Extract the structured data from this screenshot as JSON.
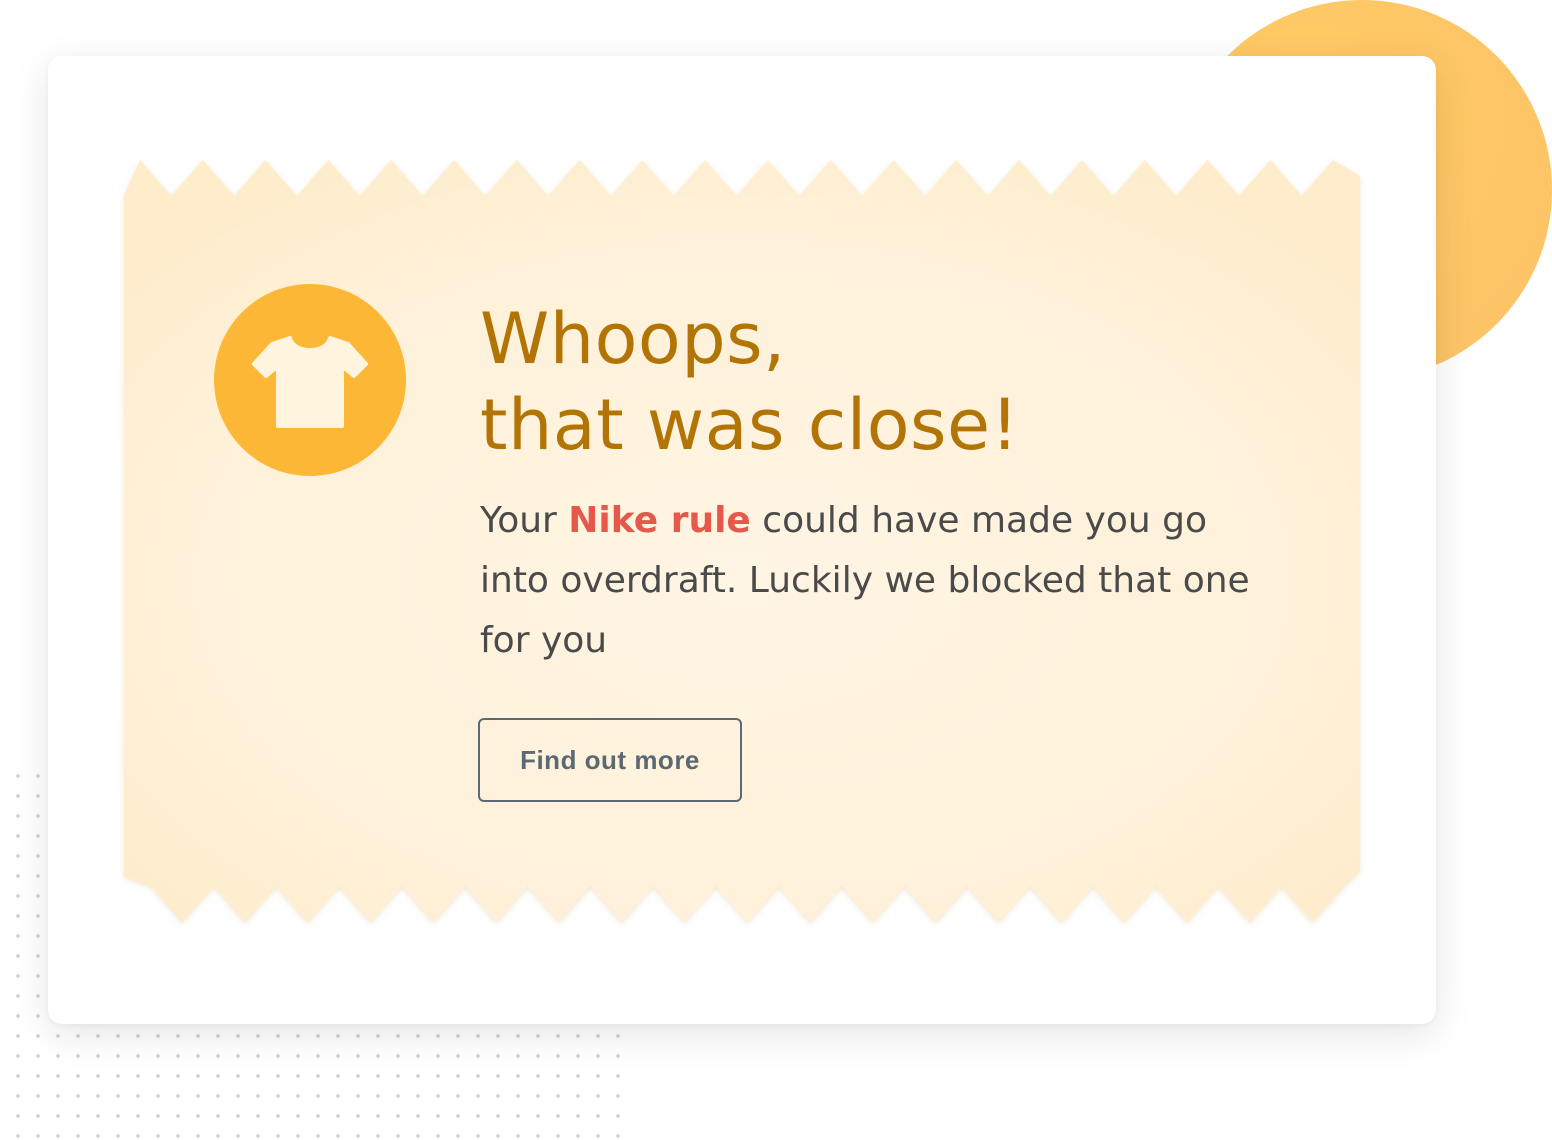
{
  "notification": {
    "headline_line1": "Whoops,",
    "headline_line2": "that was close!",
    "message_prefix": "Your ",
    "rule_name": "Nike rule",
    "message_suffix": " could have made you go into overdraft. Luckily we blocked that one for you",
    "button_label": "Find out more",
    "icon": "tshirt-icon"
  },
  "colors": {
    "accent_circle": "#fec566",
    "badge": "#fdb737",
    "ticket": "#fff1d6",
    "headline": "#b27505",
    "rule_highlight": "#e5584a",
    "body_text": "#4a4a4a",
    "button_border": "#5c6972"
  }
}
